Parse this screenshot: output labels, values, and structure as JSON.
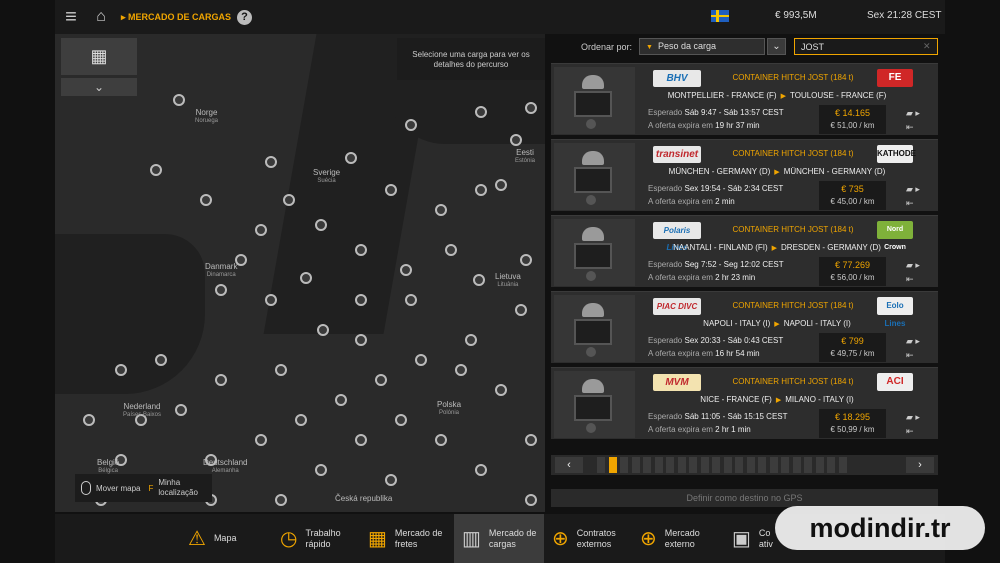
{
  "topbar": {
    "breadcrumb": "MERCADO DE CARGAS",
    "help_icon": "?",
    "money": "€ 993,5M",
    "time": "Sex 21:28 CEST"
  },
  "map": {
    "hint": "Selecione uma carga para ver os detalhes do percurso",
    "legend_move": "Mover mapa",
    "legend_location": "Minha localização",
    "countries": [
      {
        "name": "Norge",
        "sub": "Noruega"
      },
      {
        "name": "Sverige",
        "sub": "Suécia"
      },
      {
        "name": "Eesti",
        "sub": "Estónia"
      },
      {
        "name": "Danmark",
        "sub": "Dinamarca"
      },
      {
        "name": "Lietuva",
        "sub": "Lituânia"
      },
      {
        "name": "Nederland",
        "sub": "Países Baixos"
      },
      {
        "name": "Polska",
        "sub": "Polónia"
      },
      {
        "name": "België",
        "sub": "Bélgica"
      },
      {
        "name": "Deutschland",
        "sub": "Alemanha"
      },
      {
        "name": "Česká republika",
        "sub": ""
      }
    ]
  },
  "controls": {
    "sort_label": "Ordenar por:",
    "sort_value": "Peso da carga",
    "search_value": "JOST"
  },
  "jobs": [
    {
      "company_left": "BHV",
      "cargo": "CONTAINER HITCH JOST (184 t)",
      "company_right": "FE",
      "from": "MONTPELLIER - FRANCE (F)",
      "to": "TOULOUSE - FRANCE (F)",
      "time_label": "Esperado",
      "time_value": "Sáb 9:47 - Sáb 13:57 CEST",
      "expire_label": "A oferta expira em",
      "expire_value": "19 hr 37 min",
      "price": "€ 14.165",
      "rate": "€ 51,00 / km"
    },
    {
      "company_left": "transinet",
      "cargo": "CONTAINER HITCH JOST (184 t)",
      "company_right": "KATHODE",
      "from": "MÜNCHEN - GERMANY (D)",
      "to": "MÜNCHEN - GERMANY (D)",
      "time_label": "Esperado",
      "time_value": "Sex 19:54 - Sáb 2:34 CEST",
      "expire_label": "A oferta expira em",
      "expire_value": "2 min",
      "price": "€ 735",
      "rate": "€ 45,00 / km"
    },
    {
      "company_left": "Polaris Lines",
      "cargo": "CONTAINER HITCH JOST (184 t)",
      "company_right": "Nord Crown",
      "from": "NAANTALI - FINLAND (FI)",
      "to": "DRESDEN - GERMANY (D)",
      "time_label": "Esperado",
      "time_value": "Seg 7:52 - Seg 12:02 CEST",
      "expire_label": "A oferta expira em",
      "expire_value": "2 hr 23 min",
      "price": "€ 77.269",
      "rate": "€ 56,00 / km"
    },
    {
      "company_left": "PIAC DIVC",
      "cargo": "CONTAINER HITCH JOST (184 t)",
      "company_right": "Eolo Lines",
      "from": "NAPOLI - ITALY (I)",
      "to": "NAPOLI - ITALY (I)",
      "time_label": "Esperado",
      "time_value": "Sex 20:33 - Sáb 0:43 CEST",
      "expire_label": "A oferta expira em",
      "expire_value": "16 hr 54 min",
      "price": "€ 799",
      "rate": "€ 49,75 / km"
    },
    {
      "company_left": "MVM",
      "cargo": "CONTAINER HITCH JOST (184 t)",
      "company_right": "ACI",
      "from": "NICE - FRANCE (F)",
      "to": "MILANO - ITALY (I)",
      "time_label": "Esperado",
      "time_value": "Sáb 11:05 - Sáb 15:15 CEST",
      "expire_label": "A oferta expira em",
      "expire_value": "2 hr 1 min",
      "price": "€ 18.295",
      "rate": "€ 50,99 / km"
    }
  ],
  "pager": {
    "prev": "‹",
    "next": "›",
    "pages": 22,
    "current": 2
  },
  "gps_button": "Definir como destino no GPS",
  "bottom_nav": [
    {
      "icon": "map-icon",
      "label": "Mapa"
    },
    {
      "icon": "quick-job-icon",
      "label": "Trabalho rápido"
    },
    {
      "icon": "freight-market-icon",
      "label": "Mercado de fretes"
    },
    {
      "icon": "cargo-market-icon",
      "label": "Mercado de cargas"
    },
    {
      "icon": "external-contracts-icon",
      "label": "Contratos externos"
    },
    {
      "icon": "external-market-icon",
      "label": "Mercado externo"
    },
    {
      "icon": "active-contracts-icon",
      "label": "Co ativ"
    }
  ],
  "watermark": "modindir.tr",
  "colors": {
    "accent": "#f0a500",
    "panel": "#2d2d2d",
    "bar": "#1a1a1a"
  }
}
